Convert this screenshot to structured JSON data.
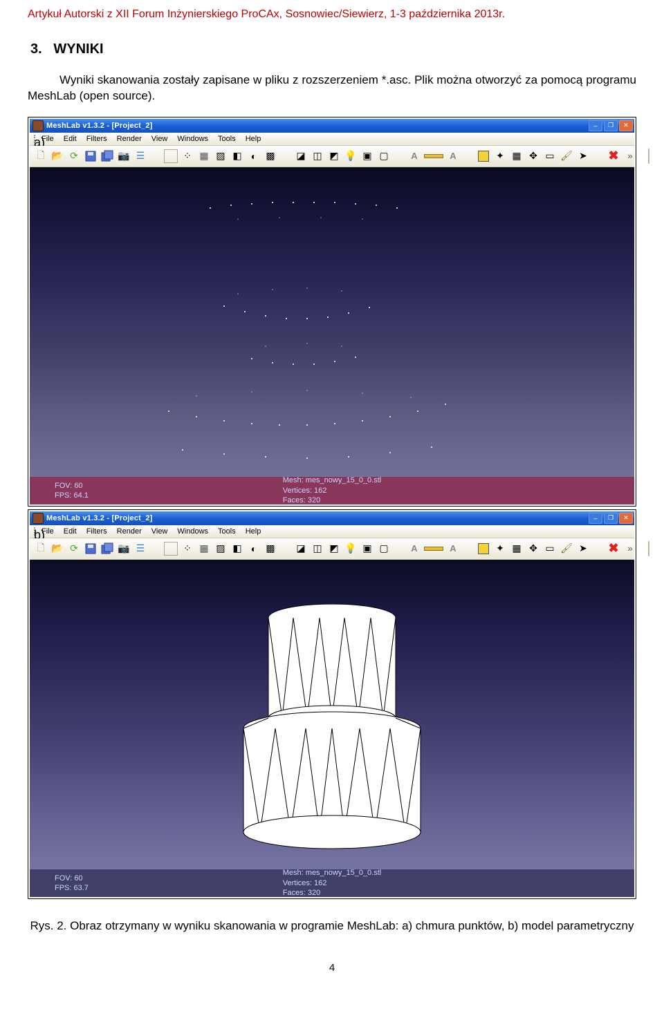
{
  "header": "Artykuł Autorski z XII Forum Inżynierskiego ProCAx, Sosnowiec/Siewierz, 1-3 października 2013r.",
  "section": {
    "num": "3.",
    "title": "WYNIKI"
  },
  "para": "Wyniki skanowania zostały zapisane w pliku z rozszerzeniem *.asc. Plik można otworzyć za pomocą programu MeshLab (open source).",
  "labels": {
    "a": "a)",
    "b": "b)"
  },
  "app": {
    "title": "MeshLab v1.3.2 - [Project_2]",
    "menu": [
      "File",
      "Edit",
      "Filters",
      "Render",
      "View",
      "Windows",
      "Tools",
      "Help"
    ]
  },
  "status_a": {
    "fov": "FOV: 60",
    "fps": "FPS: 64.1",
    "mesh": "Mesh: mes_nowy_15_0_0.stl",
    "verts": "Vertices: 162",
    "faces": "Faces: 320"
  },
  "status_b": {
    "fov": "FOV: 60",
    "fps": "FPS: 63.7",
    "mesh": "Mesh: mes_nowy_15_0_0.stl",
    "verts": "Vertices: 162",
    "faces": "Faces: 320"
  },
  "caption": "Rys. 2.  Obraz otrzymany w wyniku skanowania w programie MeshLab: a) chmura punktów, b) model parametryczny",
  "page": "4"
}
